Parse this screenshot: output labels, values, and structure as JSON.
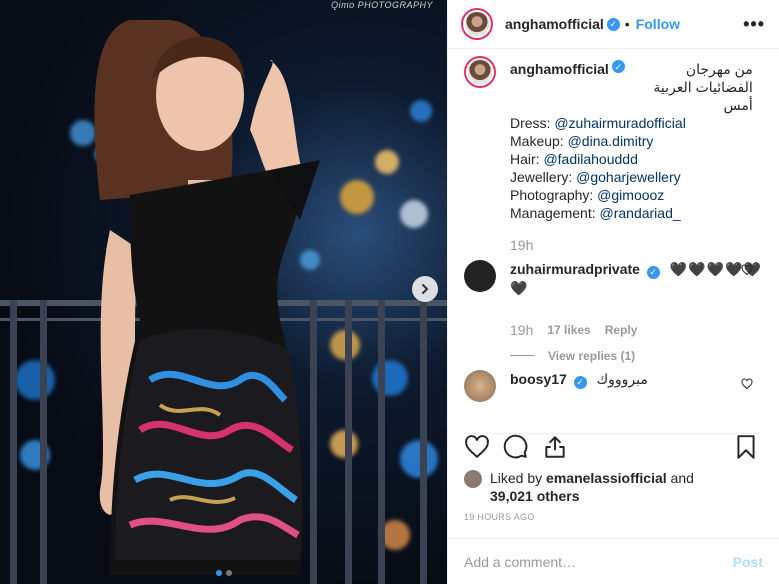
{
  "photo": {
    "watermark": "Qimo PHOTOGRAPHY",
    "carousel": {
      "total": 2,
      "active": 1
    }
  },
  "header": {
    "username": "anghamofficial",
    "separator": "•",
    "follow_label": "Follow",
    "more_label": "•••"
  },
  "caption": {
    "username": "anghamofficial",
    "text_ar": "من مهرجان الفضائيات العربية أمس",
    "credits": [
      {
        "label": "Dress: ",
        "handle": "@zuhairmuradofficial"
      },
      {
        "label": "Makeup: ",
        "handle": "@dina.dimitry"
      },
      {
        "label": "Hair: ",
        "handle": "@fadilahouddd"
      },
      {
        "label": "Jewellery: ",
        "handle": "@goharjewellery"
      },
      {
        "label": "Photography: ",
        "handle": "@gimoooz"
      },
      {
        "label": "Management: ",
        "handle": "@randariad_"
      }
    ],
    "time": "19h"
  },
  "comments": [
    {
      "username": "zuhairmuradprivate",
      "text": "🖤🖤🖤🖤🖤🖤",
      "time": "19h",
      "likes": "17 likes",
      "reply": "Reply",
      "view_replies": "View replies (1)"
    },
    {
      "username": "boosy17",
      "text": "مبروووك"
    }
  ],
  "likes": {
    "prefix": "Liked by ",
    "user": "emanelassiofficial",
    "and": " and",
    "others": "39,021 others"
  },
  "timestamp": "19 HOURS AGO",
  "add_comment": {
    "placeholder": "Add a comment…",
    "post_label": "Post"
  },
  "colors": {
    "accent": "#3897f0",
    "link": "#003569",
    "muted": "#999999",
    "post_disabled": "#b2dffc"
  }
}
